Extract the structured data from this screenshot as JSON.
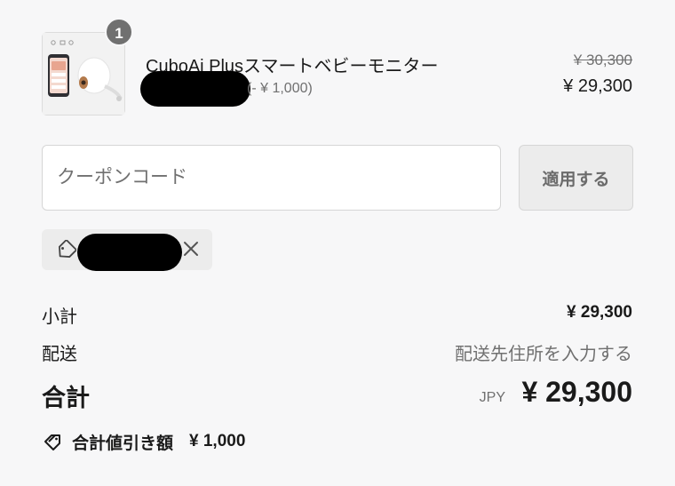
{
  "product": {
    "image_icon": "baby-monitor-product-image",
    "quantity": "1",
    "name": "CuboAi Plusスマートベビーモニター",
    "discount_note": "(- ¥ 1,000)",
    "price_original": "¥ 30,300",
    "price_final": "¥ 29,300"
  },
  "coupon": {
    "placeholder": "クーポンコード",
    "value": "",
    "apply_label": "適用する",
    "applied_tag_icon": "tag-icon",
    "remove_icon": "close-icon"
  },
  "summary": {
    "subtotal_label": "小計",
    "subtotal_value": "¥ 29,300",
    "shipping_label": "配送",
    "shipping_value": "配送先住所を入力する",
    "total_label": "合計",
    "total_currency": "JPY",
    "total_value": "¥ 29,300",
    "savings_label": "合計値引き額",
    "savings_value": "¥ 1,000",
    "savings_icon": "tags-icon"
  },
  "colors": {
    "background": "#f7f7f8",
    "text": "#1a1a1a",
    "muted": "#707070",
    "badge": "#707070",
    "redaction": "#000000"
  }
}
